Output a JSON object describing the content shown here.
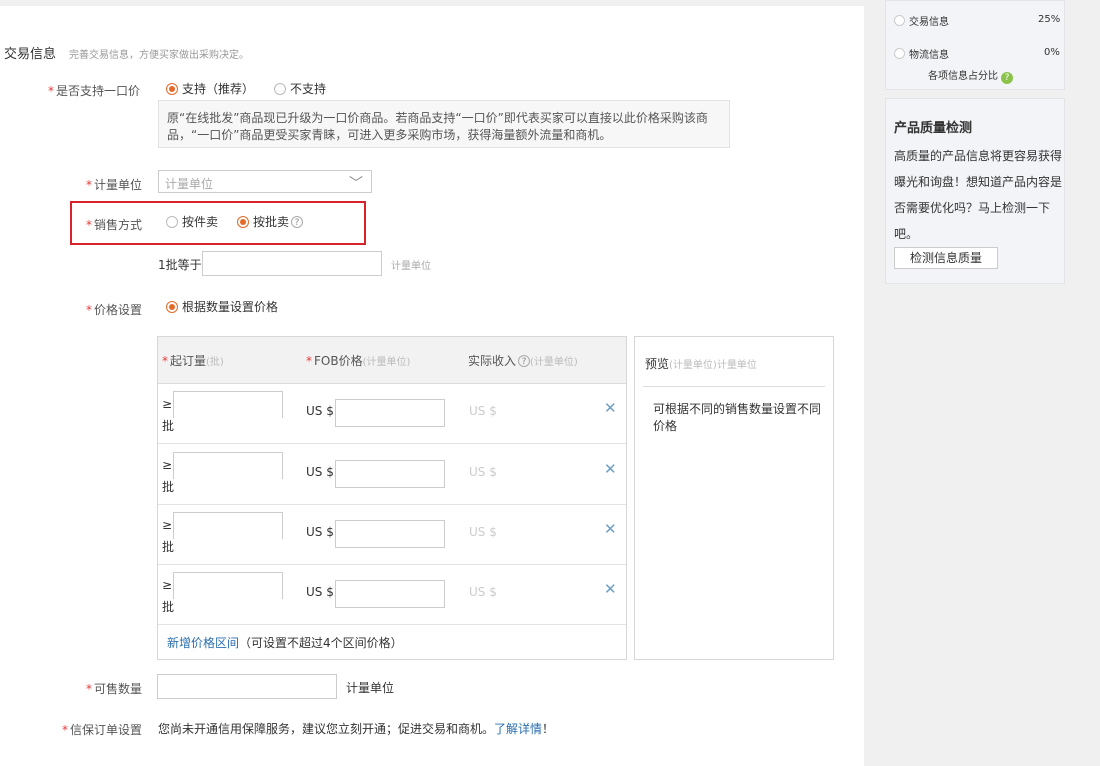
{
  "section": {
    "title": "交易信息",
    "hint": "完善交易信息，方便买家做出采购决定。"
  },
  "one_price": {
    "label": "是否支持一口价",
    "opt_yes": "支持（推荐）",
    "opt_no": "不支持",
    "selected": "yes",
    "tip": "原“在线批发”商品现已升级为一口价商品。若商品支持“一口价”即代表买家可以直接以此价格采购该商品，“一口价”商品更受买家青睐，可进入更多采购市场，获得海量额外流量和商机。"
  },
  "unit": {
    "label": "计量单位",
    "placeholder": "计量单位"
  },
  "sale_mode": {
    "label": "销售方式",
    "opt_piece": "按件卖",
    "opt_batch": "按批卖",
    "selected": "batch"
  },
  "batch": {
    "label": "1批等于",
    "unit": "计量单位"
  },
  "price_setting": {
    "label": "价格设置",
    "option": "根据数量设置价格",
    "columns": {
      "moq": "起订量",
      "moq_unit": "(批)",
      "fob": "FOB价格",
      "fob_unit": "(计量单位)",
      "actual": "实际收入",
      "actual_unit": "(计量单位)"
    },
    "rows": [
      {
        "ge": "≥",
        "unit": "批",
        "currency": "US $",
        "actual": "US $"
      },
      {
        "ge": "≥",
        "unit": "批",
        "currency": "US $",
        "actual": "US $"
      },
      {
        "ge": "≥",
        "unit": "批",
        "currency": "US $",
        "actual": "US $"
      },
      {
        "ge": "≥",
        "unit": "批",
        "currency": "US $",
        "actual": "US $"
      }
    ],
    "add_link": "新增价格区间",
    "add_note": "（可设置不超过4个区间价格）"
  },
  "preview": {
    "title": "预览",
    "unit1": "(计量单位)",
    "unit2": "计量单位",
    "text": "可根据不同的销售数量设置不同价格"
  },
  "available": {
    "label": "可售数量",
    "unit": "计量单位"
  },
  "credit_order": {
    "label": "信保订单设置",
    "text": "您尚未开通信用保障服务，建议您立刻开通；促进交易和商机。",
    "link": "了解详情",
    "tail": "！"
  },
  "side_progress": {
    "items": [
      {
        "label": "交易信息",
        "pct": "25%"
      },
      {
        "label": "物流信息",
        "pct": "0%"
      }
    ],
    "footer": "各项信息占分比"
  },
  "quality": {
    "title": "产品质量检测",
    "desc": "高质量的产品信息将更容易获得曝光和询盘！想知道产品内容是否需要优化吗？马上检测一下吧。",
    "button": "检测信息质量"
  },
  "colors": {
    "accent": "#e66a28",
    "required": "#e4393c",
    "highlight": "#d9232b",
    "link": "#2a6eb0"
  }
}
